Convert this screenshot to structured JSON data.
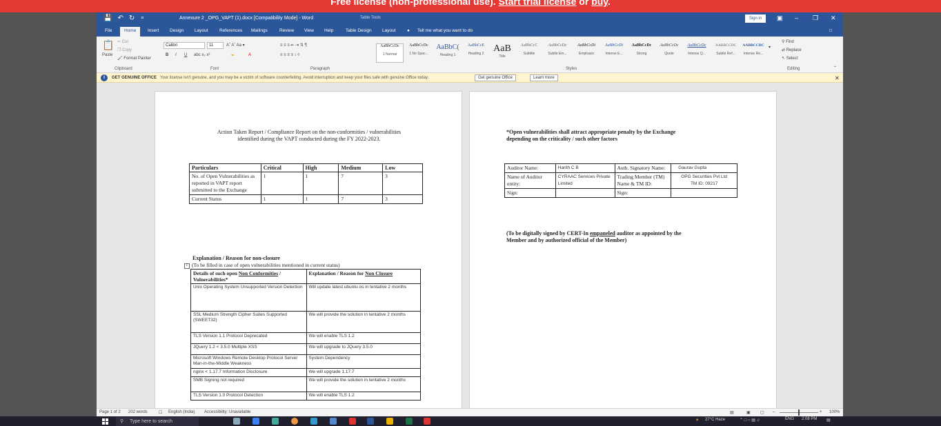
{
  "banner": {
    "prefix": "Free license (non-professional use). ",
    "link1": "Start trial license",
    "mid": " or ",
    "link2": "buy",
    "suffix": "."
  },
  "titlebar": {
    "title": "Annexure 2 _OPG_VAPT (1).docx [Compatibility Mode] - Word",
    "context": "Table Tools",
    "signin": "Sign in"
  },
  "tabs": [
    "File",
    "Home",
    "Insert",
    "Design",
    "Layout",
    "References",
    "Mailings",
    "Review",
    "View",
    "Help",
    "Table Design",
    "Layout"
  ],
  "tell_me": "Tell me what you want to do",
  "ribbon": {
    "clipboard": {
      "paste": "Paste",
      "cut": "Cut",
      "copy": "Copy",
      "format_painter": "Format Painter",
      "label": "Clipboard"
    },
    "font": {
      "name": "Calibri",
      "size": "11",
      "label": "Font"
    },
    "paragraph_label": "Paragraph",
    "styles_label": "Styles",
    "styles": [
      {
        "sample": "AaBbCcDc",
        "name": "1 Normal"
      },
      {
        "sample": "AaBbCcDc",
        "name": "1 No Spac..."
      },
      {
        "sample": "AaBbC(",
        "name": "Heading 1"
      },
      {
        "sample": "AaBbCcE",
        "name": "Heading 2"
      },
      {
        "sample": "AaB",
        "name": "Title"
      },
      {
        "sample": "AaBbCcC",
        "name": "Subtitle"
      },
      {
        "sample": "AaBbCcDc",
        "name": "Subtle Em..."
      },
      {
        "sample": "AaBbCcDi",
        "name": "Emphasis"
      },
      {
        "sample": "AaBbCcDi",
        "name": "Intense E..."
      },
      {
        "sample": "AaBbCcDc",
        "name": "Strong"
      },
      {
        "sample": "AaBbCcDc",
        "name": "Quote"
      },
      {
        "sample": "AaBbCcDc",
        "name": "Intense Q..."
      },
      {
        "sample": "AABBCCDC",
        "name": "Subtle Ref..."
      },
      {
        "sample": "AABBCCDC",
        "name": "Intense Re..."
      }
    ],
    "editing": {
      "find": "Find",
      "replace": "Replace",
      "select": "Select",
      "label": "Editing"
    }
  },
  "msgbar": {
    "title": "GET GENUINE OFFICE",
    "text": "Your license isn't genuine, and you may be a victim of software counterfeiting. Avoid interruption and keep your files safe with genuine Office today.",
    "btn1": "Get genuine Office",
    "btn2": "Learn more"
  },
  "page1": {
    "title_line1": "Action Taken Report / Compliance Report on the non-conformities / vulnerabilities",
    "title_line2": "identified during the VAPT conducted during the FY 2022-2023.",
    "summary": {
      "headers": [
        "Particulars",
        "Critical",
        "High",
        "Medium",
        "Low"
      ],
      "rows": [
        [
          "No. of Open Vulnerabilities as reported in VAPT report submitted to the Exchange",
          "1",
          "1",
          "7",
          "3"
        ],
        [
          "Current Status",
          "1",
          "1",
          "7",
          "3"
        ]
      ]
    },
    "explanation_heading": "Explanation / Reason for non-closure",
    "explanation_sub": "(To be filled in case of open vulnerabilities mentioned in current status)",
    "details": {
      "header_left_pre": "Details of such open ",
      "header_left_u": "Non Conformities",
      "header_left_post": " / Vulnerabilities*",
      "header_right_pre": "Explanation / Reason for ",
      "header_right_u": "Non Closure",
      "rows": [
        [
          "Unix Operating System Unsupported Version Detection",
          "Will update latest ubuntu os in tentative 2 months"
        ],
        [
          "SSL Medium Strength Cipher Suites Supported (SWEET32)",
          "We will provide the solution in tentative 2 months"
        ],
        [
          "TLS Version 1.1 Protocol Deprecated",
          "We will enable TLS 1.2"
        ],
        [
          "JQuery 1.2 < 3.5.0 Multiple XSS",
          "We will upgrade to JQuery 3.5.0"
        ],
        [
          "Microsoft Windows Remote Desktop Protocol Server Man-in-the-Middle Weakness",
          "System Dependency"
        ],
        [
          "nginx < 1.17.7 Information Disclosure",
          "We will upgrade 1.17.7"
        ],
        [
          "SMB Signing not required",
          "We will provide the solution in tentative 2 months"
        ],
        [
          "TLS Version 1.0 Protocol Detection",
          "We will enable TLS 1.2"
        ]
      ]
    }
  },
  "page2": {
    "note_line1": "*Open vulnerabilities shall attract appropriate penalty by the Exchange",
    "note_line2": "depending on the criticality / such other factors",
    "auditor": {
      "auditor_name_label": "Auditor Name:",
      "auditor_name": "Harith C B",
      "signatory_label": "Auth. Signatory Name:",
      "signatory": "Gaurav Gupta",
      "entity_label": "Name of Auditor entity:",
      "entity": "CYRAAC Services Private Limited",
      "tm_label": "Trading Member (TM) Name & TM ID:",
      "tm": "OPG Securities Pvt Ltd",
      "tm_id": "TM ID: 09217",
      "sign_label": "Sign:",
      "sign_label2": "Sign:"
    },
    "footer_line1_pre": "(To be digitally signed by CERT-In ",
    "footer_line1_u": "empaneled",
    "footer_line1_post": " auditor as appointed by the",
    "footer_line2": "Member and by authorized official of the Member)"
  },
  "statusbar": {
    "page": "Page 1 of 2",
    "words": "202 words",
    "lang": "English (India)",
    "access": "Accessibility: Unavailable",
    "zoom": "100%"
  },
  "taskbar": {
    "search": "Type here to search",
    "weather": "27°C  Haze",
    "lang": "ENG",
    "time": "2:08 PM"
  }
}
